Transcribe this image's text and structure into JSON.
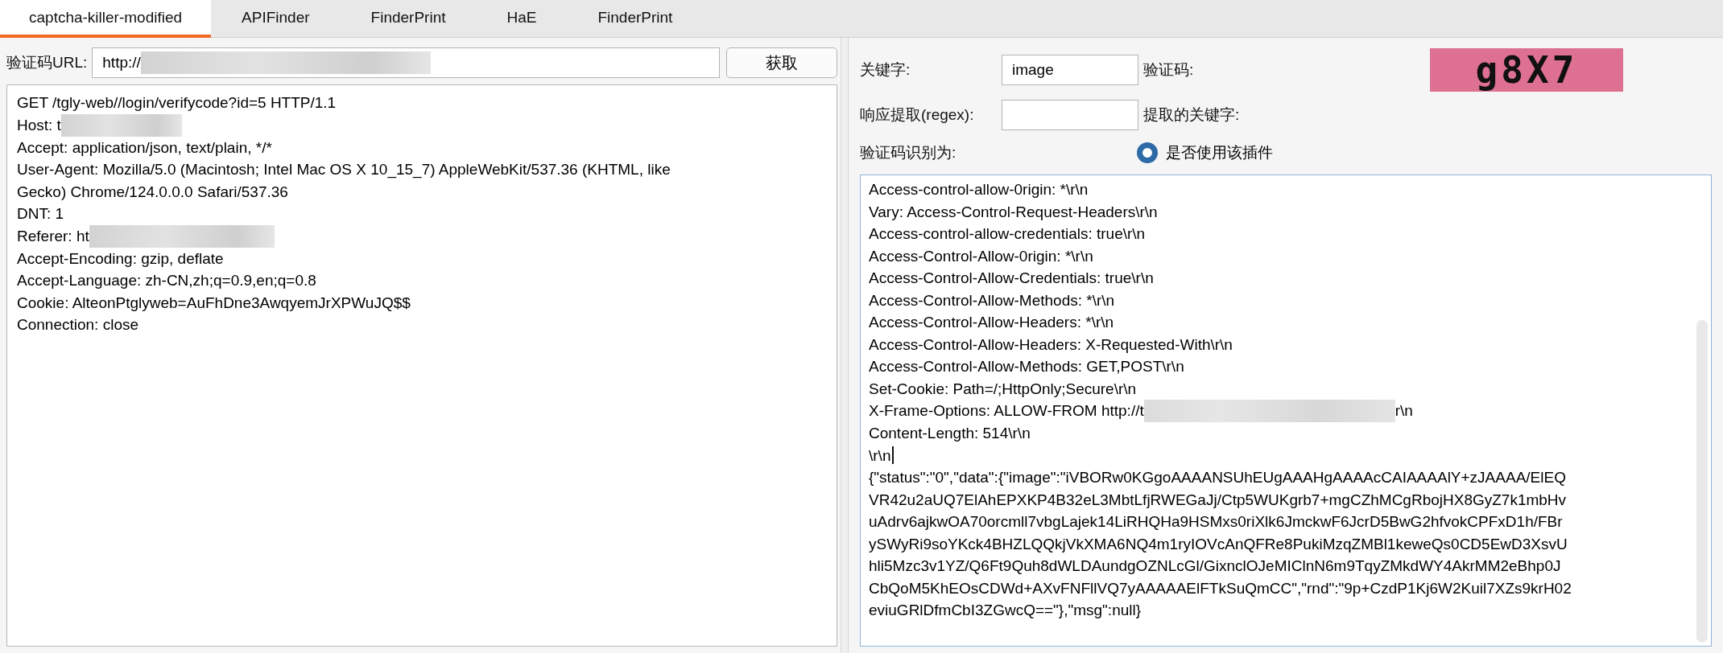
{
  "tabs": [
    {
      "label": "captcha-killer-modified",
      "selected": true
    },
    {
      "label": "APIFinder",
      "selected": false
    },
    {
      "label": "FinderPrint",
      "selected": false
    },
    {
      "label": "HaE",
      "selected": false
    },
    {
      "label": "FinderPrint",
      "selected": false
    }
  ],
  "request_panel": {
    "url_label": "验证码URL:",
    "url_value": "http://",
    "fetch_button": "获取",
    "request_lines": [
      {
        "text": "GET /tgly-web//login/verifycode?id=5 HTTP/1.1",
        "redacted": false
      },
      {
        "text": "Host: t",
        "redacted": true
      },
      {
        "text": "Accept: application/json, text/plain, */*",
        "redacted": false
      },
      {
        "text": "User-Agent: Mozilla/5.0 (Macintosh; Intel Mac OS X 10_15_7) AppleWebKit/537.36 (KHTML, like",
        "redacted": false
      },
      {
        "text": "Gecko) Chrome/124.0.0.0 Safari/537.36",
        "redacted": false
      },
      {
        "text": "DNT: 1",
        "redacted": false
      },
      {
        "text": "Referer: ht",
        "redacted": true
      },
      {
        "text": "Accept-Encoding: gzip, deflate",
        "redacted": false
      },
      {
        "text": "Accept-Language: zh-CN,zh;q=0.9,en;q=0.8",
        "redacted": false
      },
      {
        "text": "Cookie: AlteonPtglyweb=AuFhDne3AwqyemJrXPWuJQ$$",
        "redacted": false
      },
      {
        "text": "Connection: close",
        "redacted": false
      }
    ]
  },
  "settings_panel": {
    "keyword_label": "关键字:",
    "keyword_value": "image",
    "captcha_label": "验证码:",
    "captcha_text": "g8X7",
    "regex_label": "响应提取(regex):",
    "extracted_label": "提取的关键字:",
    "recognized_label": "验证码识别为:",
    "use_plugin": {
      "label": "是否使用该插件",
      "selected": true
    },
    "response_lines": [
      {
        "text": "Access-control-allow-0rigin: *\\r\\n"
      },
      {
        "text": "Vary: Access-Control-Request-Headers\\r\\n"
      },
      {
        "text": "Access-control-allow-credentials: true\\r\\n"
      },
      {
        "text": "Access-Control-Allow-0rigin: *\\r\\n"
      },
      {
        "text": "Access-Control-Allow-Credentials: true\\r\\n"
      },
      {
        "text": "Access-Control-Allow-Methods: *\\r\\n"
      },
      {
        "text": "Access-Control-Allow-Headers: *\\r\\n"
      },
      {
        "text": "Access-Control-Allow-Headers: X-Requested-With\\r\\n"
      },
      {
        "text": "Access-Control-Allow-Methods: GET,POST\\r\\n"
      },
      {
        "text": "Set-Cookie: Path=/;HttpOnly;Secure\\r\\n"
      },
      {
        "text": "X-Frame-Options: ALLOW-FROM http://t",
        "after_redaction": "r\\n"
      },
      {
        "text": "Content-Length: 514\\r\\n"
      },
      {
        "text": "\\r\\n",
        "caret": true
      },
      {
        "text": "{\"status\":\"0\",\"data\":{\"image\":\"iVBORw0KGgoAAAANSUhEUgAAAHgAAAAcCAIAAAAlY+zJAAAA/ElEQ"
      },
      {
        "text": "VR42u2aUQ7ElAhEPXKP4B32eL3MbtLfjRWEGaJj/Ctp5WUKgrb7+mgCZhMCgRbojHX8GyZ7k1mbHv"
      },
      {
        "text": "uAdrv6ajkwOA70orcmll7vbgLajek14LiRHQHa9HSMxs0riXlk6JmckwF6JcrD5BwG2hfvokCPFxD1h/FBr"
      },
      {
        "text": "ySWyRi9soYKck4BHZLQQkjVkXMA6NQ4m1ryIOVcAnQFRe8PukiMzqZMBl1keweQs0CD5EwD3XsvU"
      },
      {
        "text": "hli5Mzc3v1YZ/Q6Ft9Quh8dWLDAundgOZNLcGl/GixnclOJeMIClnN6m9TqyZMkdWY4AkrMM2eBhp0J"
      },
      {
        "text": "CbQoM5KhEOsCDWd+AXvFNFllVQ7yAAAAAElFTkSuQmCC\",\"rnd\":\"9p+CzdP1Kj6W2Kuil7XZs9krH02"
      },
      {
        "text": "eviuGRlDfmCbI3ZGwcQ==\"},\"msg\":null}"
      }
    ]
  }
}
